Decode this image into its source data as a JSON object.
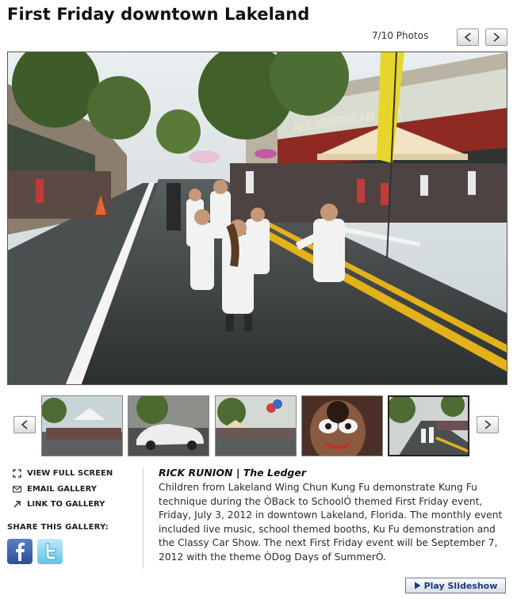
{
  "gallery": {
    "title": "First Friday downtown Lakeland",
    "counter": "7/10 Photos"
  },
  "icons": {
    "prev": "arrow-left-icon",
    "next": "arrow-right-icon",
    "fullscreen": "expand-icon",
    "email": "envelope-icon",
    "link": "link-arrow-icon",
    "facebook": "facebook-icon",
    "twitter": "twitter-icon",
    "play": "play-icon"
  },
  "actions": {
    "view_full_screen": "VIEW FULL SCREEN",
    "email_gallery": "EMAIL GALLERY",
    "link_to_gallery": "LINK TO GALLERY",
    "share_label": "SHARE THIS GALLERY:",
    "play_slideshow": "Play Slideshow"
  },
  "photo": {
    "photographer": "RICK RUNION",
    "outlet": "The Ledger",
    "caption": "Children from Lakeland Wing Chun Kung Fu demonstrate Kung Fu technique during the ÒBack to SchoolÓ themed First Friday event, Friday, July 3, 2012 in downtown Lakeland, Florida. The monthly event included live music, school themed booths, Ku Fu demonstration and the Classy Car Show. The next First Friday event will be September 7, 2012 with the theme ÒDog Days of SummerÓ."
  },
  "thumbnails": {
    "active_index": 4,
    "count_visible": 5
  },
  "colors": {
    "link_blue": "#1a3a7a",
    "facebook": "#3b5998",
    "twitter": "#5ec3e8"
  }
}
